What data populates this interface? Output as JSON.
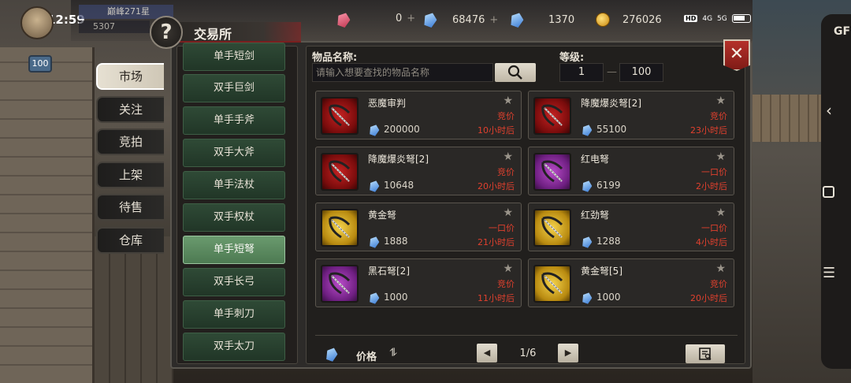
{
  "status": {
    "time": "12:59",
    "hd": "HD",
    "net1": "4G",
    "net2": "5G"
  },
  "player": {
    "name": "巅峰271星",
    "power": "5307",
    "level": "100"
  },
  "currency": {
    "red_gem": "0",
    "blue_gem": "68476",
    "locked_gem": "1370",
    "gold": "276026"
  },
  "title": "交易所",
  "help_symbol": "?",
  "side_menu": [
    {
      "label": "市场",
      "active": true
    },
    {
      "label": "关注",
      "active": false
    },
    {
      "label": "竞拍",
      "active": false
    },
    {
      "label": "上架",
      "active": false
    },
    {
      "label": "待售",
      "active": false
    },
    {
      "label": "仓库",
      "active": false
    }
  ],
  "categories": [
    {
      "label": "单手短剑",
      "active": false
    },
    {
      "label": "双手巨剑",
      "active": false
    },
    {
      "label": "单手手斧",
      "active": false
    },
    {
      "label": "双手大斧",
      "active": false
    },
    {
      "label": "单手法杖",
      "active": false
    },
    {
      "label": "双手权杖",
      "active": false
    },
    {
      "label": "单手短弩",
      "active": true
    },
    {
      "label": "双手长弓",
      "active": false
    },
    {
      "label": "单手刺刀",
      "active": false
    },
    {
      "label": "双手太刀",
      "active": false
    }
  ],
  "search": {
    "label": "物品名称:",
    "placeholder": "请输入想要查找的物品名称"
  },
  "level": {
    "label": "等级:",
    "min": "1",
    "max": "100",
    "dash": "—"
  },
  "close_symbol": "✕",
  "items": [
    {
      "name": "恶魔审判",
      "price": "200000",
      "mode": "竞价",
      "time": "10小时后",
      "color": "red"
    },
    {
      "name": "降魔爆炎弩[2]",
      "price": "55100",
      "mode": "竞价",
      "time": "23小时后",
      "color": "red"
    },
    {
      "name": "降魔爆炎弩[2]",
      "price": "10648",
      "mode": "竞价",
      "time": "20小时后",
      "color": "red"
    },
    {
      "name": "红电弩",
      "price": "6199",
      "mode": "一口价",
      "time": "2小时后",
      "color": "purple"
    },
    {
      "name": "黄金弩",
      "price": "1888",
      "mode": "一口价",
      "time": "21小时后",
      "color": "gold"
    },
    {
      "name": "红劲弩",
      "price": "1288",
      "mode": "一口价",
      "time": "4小时后",
      "color": "gold"
    },
    {
      "name": "黑石弩[2]",
      "price": "1000",
      "mode": "竞价",
      "time": "11小时后",
      "color": "purple"
    },
    {
      "name": "黄金弩[5]",
      "price": "1000",
      "mode": "竞价",
      "time": "20小时后",
      "color": "gold"
    }
  ],
  "footer": {
    "sort_label": "价格",
    "sort_arrow": "⥮",
    "prev": "◀",
    "next": "▶",
    "page": "1/6"
  },
  "overlay": {
    "text": "GF"
  }
}
